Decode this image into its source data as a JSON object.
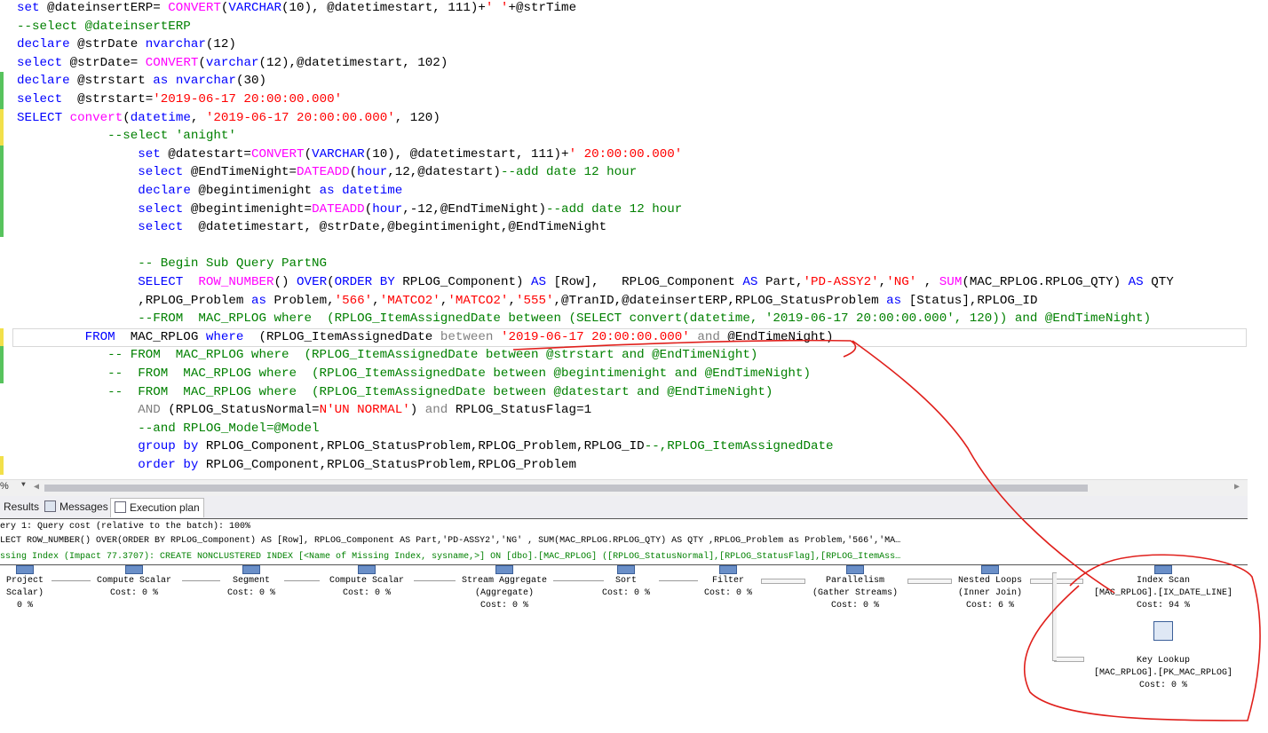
{
  "editor": {
    "lines": [
      {
        "mark": "",
        "t": [
          [
            "set",
            "kw"
          ],
          [
            " @dateinsertERP= ",
            "tx"
          ],
          [
            "CONVERT",
            "fn"
          ],
          [
            "(",
            "tx"
          ],
          [
            "VARCHAR",
            "kw"
          ],
          [
            "(10), @datetimestart, 111)+",
            "tx"
          ],
          [
            "' '",
            "str"
          ],
          [
            "+@strTime",
            "tx"
          ]
        ]
      },
      {
        "mark": "",
        "t": [
          [
            "--select @dateinsertERP",
            "cm"
          ]
        ]
      },
      {
        "mark": "",
        "t": [
          [
            "declare",
            "kw"
          ],
          [
            " @strDate ",
            "tx"
          ],
          [
            "nvarchar",
            "kw"
          ],
          [
            "(12)",
            "tx"
          ]
        ]
      },
      {
        "mark": "",
        "t": [
          [
            "select",
            "kw"
          ],
          [
            " @strDate= ",
            "tx"
          ],
          [
            "CONVERT",
            "fn"
          ],
          [
            "(",
            "tx"
          ],
          [
            "varchar",
            "kw"
          ],
          [
            "(12),@datetimestart, 102)",
            "tx"
          ]
        ]
      },
      {
        "mark": "g",
        "t": [
          [
            "declare",
            "kw"
          ],
          [
            " @strstart ",
            "tx"
          ],
          [
            "as",
            "kw"
          ],
          [
            " ",
            "tx"
          ],
          [
            "nvarchar",
            "kw"
          ],
          [
            "(30)",
            "tx"
          ]
        ]
      },
      {
        "mark": "g",
        "t": [
          [
            "select",
            "kw"
          ],
          [
            "  @strstart=",
            "tx"
          ],
          [
            "'2019-06-17 20:00:00.000'",
            "str"
          ]
        ]
      },
      {
        "mark": "y",
        "t": [
          [
            "SELECT",
            "kw"
          ],
          [
            " ",
            "tx"
          ],
          [
            "convert",
            "fn"
          ],
          [
            "(",
            "tx"
          ],
          [
            "datetime",
            "kw"
          ],
          [
            ", ",
            "tx"
          ],
          [
            "'2019-06-17 20:00:00.000'",
            "str"
          ],
          [
            ", 120)",
            "tx"
          ]
        ]
      },
      {
        "mark": "y",
        "t": [
          [
            "            --select 'anight'",
            "cm"
          ]
        ]
      },
      {
        "mark": "g",
        "t": [
          [
            "                ",
            "tx"
          ],
          [
            "set",
            "kw"
          ],
          [
            " @datestart=",
            "tx"
          ],
          [
            "CONVERT",
            "fn"
          ],
          [
            "(",
            "tx"
          ],
          [
            "VARCHAR",
            "kw"
          ],
          [
            "(10), @datetimestart, 111)+",
            "tx"
          ],
          [
            "' 20:00:00.000'",
            "str"
          ]
        ]
      },
      {
        "mark": "g",
        "t": [
          [
            "                ",
            "tx"
          ],
          [
            "select",
            "kw"
          ],
          [
            " @EndTimeNight=",
            "tx"
          ],
          [
            "DATEADD",
            "fn"
          ],
          [
            "(",
            "tx"
          ],
          [
            "hour",
            "kw"
          ],
          [
            ",12,@datestart)",
            "tx"
          ],
          [
            "--add date 12 hour",
            "cm"
          ]
        ]
      },
      {
        "mark": "g",
        "t": [
          [
            "                ",
            "tx"
          ],
          [
            "declare",
            "kw"
          ],
          [
            " @begintimenight ",
            "tx"
          ],
          [
            "as",
            "kw"
          ],
          [
            " ",
            "tx"
          ],
          [
            "datetime",
            "kw"
          ]
        ]
      },
      {
        "mark": "g",
        "t": [
          [
            "                ",
            "tx"
          ],
          [
            "select",
            "kw"
          ],
          [
            " @begintimenight=",
            "tx"
          ],
          [
            "DATEADD",
            "fn"
          ],
          [
            "(",
            "tx"
          ],
          [
            "hour",
            "kw"
          ],
          [
            ",-12,@EndTimeNight)",
            "tx"
          ],
          [
            "--add date 12 hour",
            "cm"
          ]
        ]
      },
      {
        "mark": "g",
        "t": [
          [
            "                ",
            "tx"
          ],
          [
            "select",
            "kw"
          ],
          [
            "  @datetimestart, @strDate,@begintimenight,@EndTimeNight",
            "tx"
          ]
        ]
      },
      {
        "mark": "",
        "t": []
      },
      {
        "mark": "",
        "t": [
          [
            "                -- Begin Sub Query PartNG",
            "cm"
          ]
        ]
      },
      {
        "mark": "",
        "t": [
          [
            "                ",
            "tx"
          ],
          [
            "SELECT",
            "kw"
          ],
          [
            "  ",
            "tx"
          ],
          [
            "ROW_NUMBER",
            "fn"
          ],
          [
            "() ",
            "tx"
          ],
          [
            "OVER",
            "kw"
          ],
          [
            "(",
            "tx"
          ],
          [
            "ORDER BY",
            "kw"
          ],
          [
            " RPLOG_Component) ",
            "tx"
          ],
          [
            "AS",
            "kw"
          ],
          [
            " [Row],   RPLOG_Component ",
            "tx"
          ],
          [
            "AS",
            "kw"
          ],
          [
            " Part,",
            "tx"
          ],
          [
            "'PD-ASSY2'",
            "str"
          ],
          [
            ",",
            "tx"
          ],
          [
            "'NG'",
            "str"
          ],
          [
            " , ",
            "tx"
          ],
          [
            "SUM",
            "fn"
          ],
          [
            "(MAC_RPLOG.RPLOG_QTY) ",
            "tx"
          ],
          [
            "AS",
            "kw"
          ],
          [
            " QTY",
            "tx"
          ]
        ]
      },
      {
        "mark": "",
        "t": [
          [
            "                ,RPLOG_Problem ",
            "tx"
          ],
          [
            "as",
            "kw"
          ],
          [
            " Problem,",
            "tx"
          ],
          [
            "'566'",
            "str"
          ],
          [
            ",",
            "tx"
          ],
          [
            "'MATCO2'",
            "str"
          ],
          [
            ",",
            "tx"
          ],
          [
            "'MATCO2'",
            "str"
          ],
          [
            ",",
            "tx"
          ],
          [
            "'555'",
            "str"
          ],
          [
            ",@TranID,@dateinsertERP,RPLOG_StatusProblem ",
            "tx"
          ],
          [
            "as",
            "kw"
          ],
          [
            " [Status],RPLOG_ID",
            "tx"
          ]
        ]
      },
      {
        "mark": "",
        "t": [
          [
            "                --FROM  MAC_RPLOG where  (RPLOG_ItemAssignedDate between (SELECT convert(datetime, '2019-06-17 20:00:00.000', 120)) and @EndTimeNight)",
            "cm"
          ]
        ]
      },
      {
        "mark": "y",
        "t": [
          [
            "         ",
            "tx"
          ],
          [
            "FROM",
            "kw"
          ],
          [
            "  MAC_RPLOG ",
            "tx"
          ],
          [
            "where",
            "kw"
          ],
          [
            "  (RPLOG_ItemAssignedDate ",
            "tx"
          ],
          [
            "between",
            "gr"
          ],
          [
            " ",
            "tx"
          ],
          [
            "'2019-06-17 20:00:00.000'",
            "str"
          ],
          [
            " ",
            "tx"
          ],
          [
            "and",
            "gr"
          ],
          [
            " @EndTimeNight)",
            "tx"
          ]
        ]
      },
      {
        "mark": "g",
        "t": [
          [
            "            -- FROM  MAC_RPLOG where  (RPLOG_ItemAssignedDate between @strstart and @EndTimeNight)",
            "cm"
          ]
        ]
      },
      {
        "mark": "g",
        "t": [
          [
            "            --  FROM  MAC_RPLOG where  (RPLOG_ItemAssignedDate between @begintimenight and @EndTimeNight)",
            "cm"
          ]
        ]
      },
      {
        "mark": "",
        "t": [
          [
            "            --  FROM  MAC_RPLOG where  (RPLOG_ItemAssignedDate between @datestart and @EndTimeNight)",
            "cm"
          ]
        ]
      },
      {
        "mark": "",
        "t": [
          [
            "                ",
            "tx"
          ],
          [
            "AND",
            "gr"
          ],
          [
            " (RPLOG_StatusNormal=",
            "tx"
          ],
          [
            "N'UN NORMAL'",
            "str"
          ],
          [
            ") ",
            "tx"
          ],
          [
            "and",
            "gr"
          ],
          [
            " RPLOG_StatusFlag=1",
            "tx"
          ]
        ]
      },
      {
        "mark": "",
        "t": [
          [
            "                --and RPLOG_Model=@Model",
            "cm"
          ]
        ]
      },
      {
        "mark": "",
        "t": [
          [
            "                ",
            "tx"
          ],
          [
            "group by",
            "kw"
          ],
          [
            " RPLOG_Component,RPLOG_StatusProblem,RPLOG_Problem,RPLOG_ID",
            "tx"
          ],
          [
            "--,RPLOG_ItemAssignedDate",
            "cm"
          ]
        ]
      },
      {
        "mark": "y",
        "t": [
          [
            "                ",
            "tx"
          ],
          [
            "order by",
            "kw"
          ],
          [
            " RPLOG_Component,RPLOG_StatusProblem,RPLOG_Problem",
            "tx"
          ]
        ]
      }
    ],
    "current_line": 18
  },
  "statusbar": {
    "zoom": "%"
  },
  "tabs": [
    {
      "label": "Results",
      "icon": "grid-icon"
    },
    {
      "label": "Messages",
      "icon": "messages-icon"
    },
    {
      "label": "Execution plan",
      "icon": "execution-plan-icon",
      "active": true
    }
  ],
  "plan": {
    "query_cost": "ery 1: Query cost (relative to the batch): 100%",
    "query_text": "LECT ROW_NUMBER() OVER(ORDER BY RPLOG_Component) AS [Row], RPLOG_Component AS Part,'PD-ASSY2','NG' , SUM(MAC_RPLOG.RPLOG_QTY) AS QTY ,RPLOG_Problem as Problem,'566','MA…",
    "missing_index": "ssing Index (Impact 77.3707): CREATE NONCLUSTERED INDEX [<Name of Missing Index, sysname,>] ON [dbo].[MAC_RPLOG] ([RPLOG_StatusNormal],[RPLOG_StatusFlag],[RPLOG_ItemAss…",
    "nodes": [
      {
        "l1": "Project",
        "l2": "Scalar)",
        "l3": "0 %"
      },
      {
        "l1": "Compute Scalar",
        "l2": "Cost: 0 %",
        "l3": ""
      },
      {
        "l1": "Segment",
        "l2": "Cost: 0 %",
        "l3": ""
      },
      {
        "l1": "Compute Scalar",
        "l2": "Cost: 0 %",
        "l3": ""
      },
      {
        "l1": "Stream Aggregate",
        "l2": "(Aggregate)",
        "l3": "Cost: 0 %"
      },
      {
        "l1": "Sort",
        "l2": "Cost: 0 %",
        "l3": ""
      },
      {
        "l1": "Filter",
        "l2": "Cost: 0 %",
        "l3": ""
      },
      {
        "l1": "Parallelism",
        "l2": "(Gather Streams)",
        "l3": "Cost: 0 %"
      },
      {
        "l1": "Nested Loops",
        "l2": "(Inner Join)",
        "l3": "Cost: 6 %"
      },
      {
        "l1": "Index Scan",
        "l2": "[MAC_RPLOG].[IX_DATE_LINE]",
        "l3": "Cost: 94 %"
      },
      {
        "l1": "Key Lookup",
        "l2": "[MAC_RPLOG].[PK_MAC_RPLOG]",
        "l3": "Cost: 0 %"
      }
    ]
  },
  "colors": {
    "keyword": "#0000ff",
    "function": "#ff00ff",
    "string": "#ff0000",
    "comment": "#008000",
    "operator": "#808080",
    "annotation": "#e0201c"
  }
}
